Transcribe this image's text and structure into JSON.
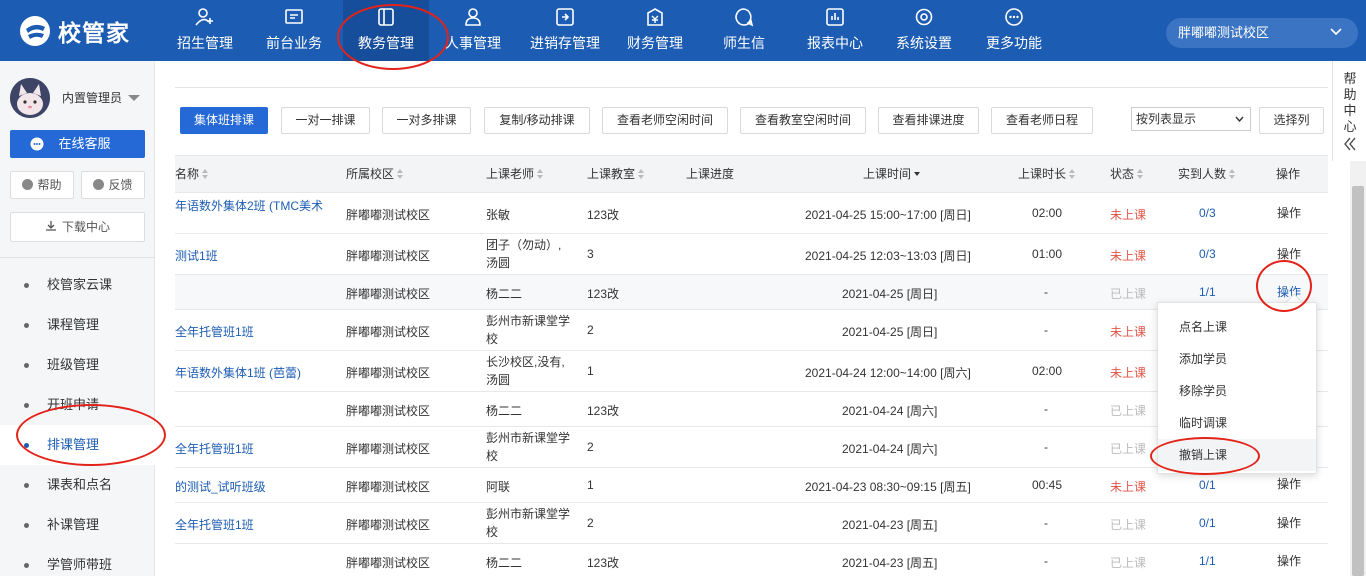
{
  "app": {
    "name": "校管家"
  },
  "nav": [
    {
      "label": "招生管理",
      "icon": "user-plus-icon"
    },
    {
      "label": "前台业务",
      "icon": "monitor-icon"
    },
    {
      "label": "教务管理",
      "icon": "book-icon",
      "active": true
    },
    {
      "label": "人事管理",
      "icon": "person-icon"
    },
    {
      "label": "进销存管理",
      "icon": "inventory-icon"
    },
    {
      "label": "财务管理",
      "icon": "finance-icon"
    },
    {
      "label": "师生信",
      "icon": "message-icon"
    },
    {
      "label": "报表中心",
      "icon": "report-icon"
    },
    {
      "label": "系统设置",
      "icon": "settings-icon"
    },
    {
      "label": "更多功能",
      "icon": "more-icon"
    }
  ],
  "campus_selector": {
    "value": "胖嘟嘟测试校区"
  },
  "sidebar": {
    "user_name": "内置管理员",
    "kefu_label": "在线客服",
    "help_label": "帮助",
    "feedback_label": "反馈",
    "download_label": "下载中心",
    "menu": [
      {
        "label": "校管家云课"
      },
      {
        "label": "课程管理"
      },
      {
        "label": "班级管理"
      },
      {
        "label": "开班申请"
      },
      {
        "label": "排课管理",
        "active": true
      },
      {
        "label": "课表和点名"
      },
      {
        "label": "补课管理"
      },
      {
        "label": "学管师带班"
      }
    ]
  },
  "toolbar": {
    "buttons": [
      {
        "label": "集体班排课",
        "primary": true
      },
      {
        "label": "一对一排课"
      },
      {
        "label": "一对多排课"
      },
      {
        "label": "复制/移动排课"
      },
      {
        "label": "查看老师空闲时间"
      },
      {
        "label": "查看教室空闲时间"
      },
      {
        "label": "查看排课进度"
      },
      {
        "label": "查看老师日程"
      }
    ],
    "view_select": "按列表显示",
    "select_columns_label": "选择列"
  },
  "table": {
    "headers": {
      "name": "名称",
      "campus": "所属校区",
      "teacher": "上课老师",
      "room": "上课教室",
      "progress": "上课进度",
      "time": "上课时间",
      "duration": "上课时长",
      "status": "状态",
      "attendance": "实到人数",
      "action": "操作"
    },
    "rows": [
      {
        "name": "年语数外集体2班 (TMC美术",
        "campus": "胖嘟嘟测试校区",
        "teacher": "张敏",
        "room": "123改",
        "time": "2021-04-25 15:00~17:00 [周日]",
        "duration": "02:00",
        "status": "未上课",
        "attendance": "0/3",
        "action": "操作"
      },
      {
        "name": "测试1班",
        "campus": "胖嘟嘟测试校区",
        "teacher": "团子（勿动）, 汤圆",
        "room": "3",
        "time": "2021-04-25 12:03~13:03 [周日]",
        "duration": "01:00",
        "status": "未上课",
        "attendance": "0/3",
        "action": "操作"
      },
      {
        "name": "",
        "campus": "胖嘟嘟测试校区",
        "teacher": "杨二二",
        "room": "123改",
        "time": "2021-04-25 [周日]",
        "duration": "-",
        "status": "已上课",
        "attendance": "1/1",
        "action": "操作"
      },
      {
        "name": "全年托管班1班",
        "campus": "胖嘟嘟测试校区",
        "teacher": "彭州市新课堂学校",
        "room": "2",
        "time": "2021-04-25 [周日]",
        "duration": "-",
        "status": "未上课",
        "attendance": "",
        "action": ""
      },
      {
        "name": "年语数外集体1班 (芭蕾)",
        "campus": "胖嘟嘟测试校区",
        "teacher": "长沙校区,没有, 汤圆",
        "room": "1",
        "time": "2021-04-24 12:00~14:00 [周六]",
        "duration": "02:00",
        "status": "未上课",
        "attendance": "",
        "action": ""
      },
      {
        "name": "",
        "campus": "胖嘟嘟测试校区",
        "teacher": "杨二二",
        "room": "123改",
        "time": "2021-04-24 [周六]",
        "duration": "-",
        "status": "已上课",
        "attendance": "",
        "action": ""
      },
      {
        "name": "全年托管班1班",
        "campus": "胖嘟嘟测试校区",
        "teacher": "彭州市新课堂学校",
        "room": "2",
        "time": "2021-04-24 [周六]",
        "duration": "-",
        "status": "已上课",
        "attendance": "",
        "action": ""
      },
      {
        "name": "的测试_试听班级",
        "campus": "胖嘟嘟测试校区",
        "teacher": "阿联",
        "room": "1",
        "time": "2021-04-23 08:30~09:15 [周五]",
        "duration": "00:45",
        "status": "未上课",
        "attendance": "0/1",
        "action": "操作"
      },
      {
        "name": "全年托管班1班",
        "campus": "胖嘟嘟测试校区",
        "teacher": "彭州市新课堂学校",
        "room": "2",
        "time": "2021-04-23 [周五]",
        "duration": "-",
        "status": "已上课",
        "attendance": "0/1",
        "action": "操作"
      },
      {
        "name": "",
        "campus": "胖嘟嘟测试校区",
        "teacher": "杨二二",
        "room": "123改",
        "time": "2021-04-23 [周五]",
        "duration": "-",
        "status": "已上课",
        "attendance": "1/1",
        "action": "操作"
      }
    ]
  },
  "dropdown": {
    "items": [
      {
        "label": "点名上课"
      },
      {
        "label": "添加学员"
      },
      {
        "label": "移除学员"
      },
      {
        "label": "临时调课"
      },
      {
        "label": "撤销上课"
      }
    ]
  },
  "help_panel": {
    "label": "帮助中心"
  },
  "colors": {
    "primary": "#1c5cb3",
    "button": "#2569d6",
    "not_started": "#e05547",
    "done": "#bbbbbb",
    "annotation": "#e2231a"
  }
}
